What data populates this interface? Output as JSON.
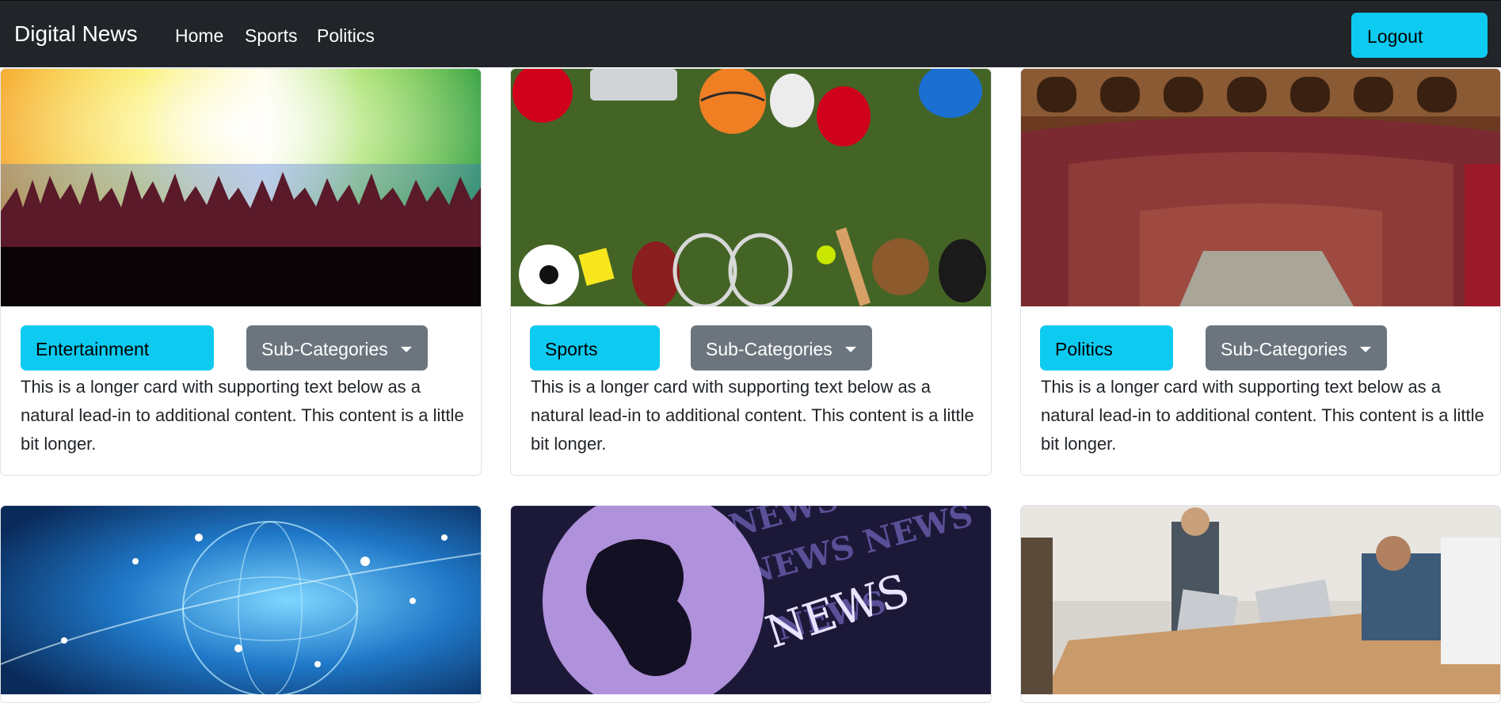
{
  "navbar": {
    "brand": "Digital News",
    "links": [
      "Home",
      "Sports",
      "Politics"
    ],
    "logout": "Logout"
  },
  "cards": [
    {
      "category": "Entertainment",
      "subcategories": "Sub-Categories",
      "text": "This is a longer card with supporting text below as a natural lead-in to additional content. This content is a little bit longer.",
      "image": "concert-crowd-image"
    },
    {
      "category": "Sports",
      "subcategories": "Sub-Categories",
      "text": "This is a longer card with supporting text below as a natural lead-in to additional content. This content is a little bit longer.",
      "image": "sports-equipment-image"
    },
    {
      "category": "Politics",
      "subcategories": "Sub-Categories",
      "text": "This is a longer card with supporting text below as a natural lead-in to additional content. This content is a little bit longer.",
      "image": "parliament-chamber-image"
    },
    {
      "image": "global-network-image"
    },
    {
      "image": "news-globe-image",
      "image_text": "NEWS"
    },
    {
      "image": "business-meeting-image"
    }
  ],
  "colors": {
    "navbar": "#212529",
    "info": "#0dcaf0",
    "secondary": "#6c757d"
  }
}
